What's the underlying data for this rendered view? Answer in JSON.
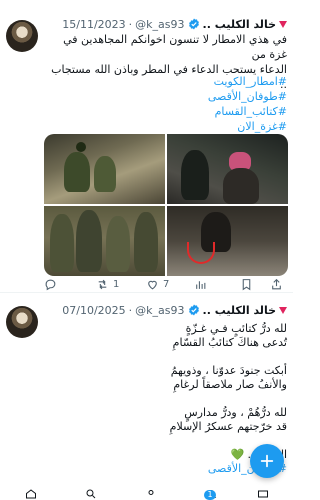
{
  "tweet1": {
    "name": "خالد الكليب ..",
    "handle": "@k_as93",
    "date": "15/11/2023",
    "separator": "·",
    "text_lines": [
      "في هذي الامطار لا تنسون اخوانكم المجاهدين في غزة من",
      "الدعاء يستحب الدعاء في المطر وباذن الله مستجاب .."
    ],
    "hashtags": [
      "#امطار_الكويت",
      "#طوفان_الأقصى",
      "#كتائب_القسام",
      "#غزة_الان"
    ],
    "media_count": 4,
    "actions": {
      "reply_count": "",
      "retweet_count": "1",
      "like_count": "7",
      "views_count": "",
      "bookmark_count": ""
    }
  },
  "tweet2": {
    "name": "خالد الكليب ..",
    "handle": "@k_as93",
    "date": "07/10/2025",
    "separator": "·",
    "text_lines": [
      "لله درُّ كتائبٍ فـي غـزّةٍ",
      "تُدعى هناكَ كتائبُ القسّامِ",
      "",
      "أبكت جنودَ عدوّنا ، وذويهمُ",
      "والأنفُ صار ملاصقاً لرغامِ",
      "",
      "لله درُّهُمْ ، ودرُّ مدارسٍ",
      "قد خرّجتهم عسكرُ الإسلامِ",
      "",
      "المجيد .."
    ],
    "hashtag": "#طوفان_الأقصى",
    "emoji": "💚"
  },
  "fab": {
    "icon": "plus-icon"
  },
  "tabbar": {
    "notifications_badge": "1"
  },
  "colors": {
    "accent": "#1d9bf0",
    "text": "#0f1419",
    "muted": "#536471",
    "alert": "#e0245e"
  }
}
